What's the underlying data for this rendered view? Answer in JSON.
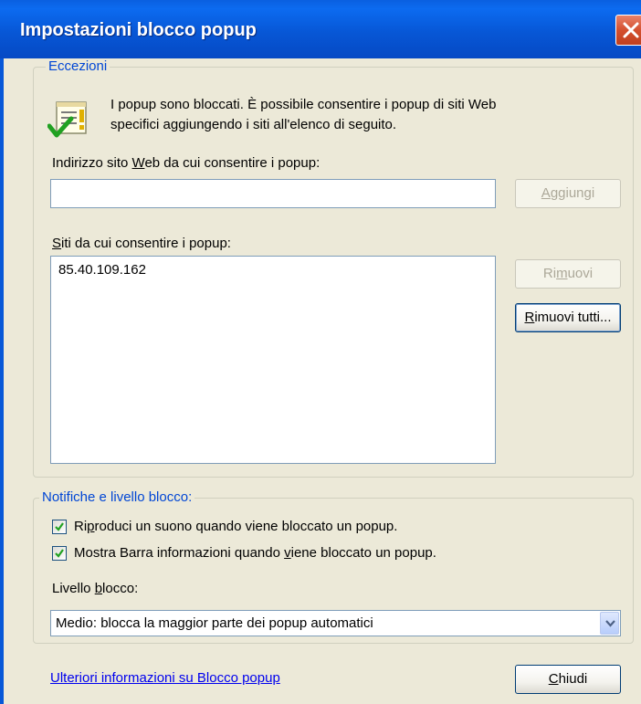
{
  "window": {
    "title": "Impostazioni blocco popup",
    "close_icon": "close-icon"
  },
  "exceptions": {
    "legend": "Eccezioni",
    "icon": "info-checkmark-icon",
    "info_line1": "I popup sono bloccati. È possibile consentire i popup di siti Web",
    "info_line2": "specifici aggiungendo i siti all'elenco di seguito.",
    "address_label": {
      "pre": "Indirizzo sito ",
      "acc": "W",
      "post": "eb da cui consentire i popup:"
    },
    "address_value": "",
    "add_button": {
      "acc": "A",
      "post": "ggiungi"
    },
    "sites_label": {
      "acc": "S",
      "post": "iti da cui consentire i popup:"
    },
    "sites": [
      "85.40.109.162"
    ],
    "remove_button": {
      "pre": "Ri",
      "acc": "m",
      "post": "uovi"
    },
    "remove_all_button": {
      "acc": "R",
      "post": "imuovi tutti..."
    }
  },
  "notifications": {
    "legend": "Notifiche e livello blocco:",
    "sound_checkbox": {
      "checked": true,
      "pre": "Ri",
      "acc": "p",
      "post": "roduci un suono quando viene bloccato un popup."
    },
    "infobar_checkbox": {
      "checked": true,
      "pre": "Mostra Barra informazioni quando ",
      "acc": "v",
      "post": "iene bloccato un popup."
    },
    "level_label": {
      "pre": "Livello ",
      "acc": "b",
      "post": "locco:"
    },
    "level_value": "Medio: blocca la maggior parte dei popup automatici"
  },
  "footer": {
    "link": "Ulteriori informazioni su Blocco popup",
    "close_button": {
      "acc": "C",
      "post": "hiudi"
    }
  },
  "colors": {
    "title_bar": "#0757d6",
    "dialog_bg": "#ece9d8",
    "legend_text": "#0046d5",
    "link": "#0000ee",
    "check": "#21a121"
  }
}
